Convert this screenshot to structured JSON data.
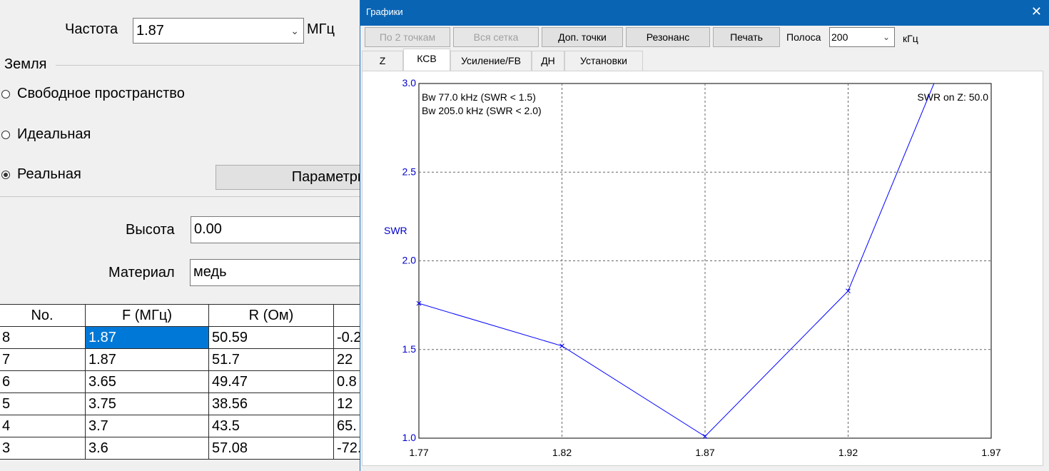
{
  "dialog": {
    "frequency_label": "Частота",
    "frequency_value": "1.87",
    "frequency_unit": "МГц",
    "ground_group_label": "Земля",
    "ground_options": [
      "Свободное пространство",
      "Идеальная",
      "Реальная"
    ],
    "ground_selected": "Реальная",
    "params_button": "Параметры",
    "height_label": "Высота",
    "height_value": "0.00",
    "material_label": "Материал",
    "material_value": "медь",
    "table": {
      "headers": [
        "No.",
        "F (МГц)",
        "R (Ом)",
        ""
      ],
      "rows": [
        [
          "8",
          "1.87",
          "50.59",
          "-0.2"
        ],
        [
          "7",
          "1.87",
          "51.7",
          "22"
        ],
        [
          "6",
          "3.65",
          "49.47",
          "0.8"
        ],
        [
          "5",
          "3.75",
          "38.56",
          "12"
        ],
        [
          "4",
          "3.7",
          "43.5",
          "65."
        ],
        [
          "3",
          "3.6",
          "57.08",
          "-72."
        ]
      ]
    }
  },
  "graphs_window": {
    "title": "Графики",
    "close_glyph": "✕",
    "toolbar": {
      "by_two_points": "По 2 точкам",
      "whole_grid": "Вся сетка",
      "extra_points": "Доп. точки",
      "resonance": "Резонанс",
      "print": "Печать",
      "band_label": "Полоса",
      "band_value": "200",
      "band_unit": "кГц"
    },
    "tabs": [
      "Z",
      "КСВ",
      "Усиление/FB",
      "ДН",
      "Установки"
    ],
    "active_tab": "КСВ"
  },
  "chart_data": {
    "type": "line",
    "ylabel": "SWR",
    "xlim": [
      1.77,
      1.97
    ],
    "ylim": [
      1.0,
      3.0
    ],
    "x_ticks": [
      "1.77",
      "1.82",
      "1.87",
      "1.92",
      "1.97"
    ],
    "y_ticks": [
      "1.0",
      "1.5",
      "2.0",
      "2.5",
      "3.0"
    ],
    "grid": true,
    "annotations": [
      "Bw 77.0 kHz (SWR < 1.5)",
      "Bw 205.0 kHz (SWR < 2.0)"
    ],
    "corner_note": "SWR on Z: 50.0",
    "series": [
      {
        "x": [
          1.77,
          1.82,
          1.87,
          1.92,
          1.95
        ],
        "y": [
          1.76,
          1.52,
          1.01,
          1.83,
          3.0
        ]
      }
    ],
    "color": "#0000ff"
  }
}
